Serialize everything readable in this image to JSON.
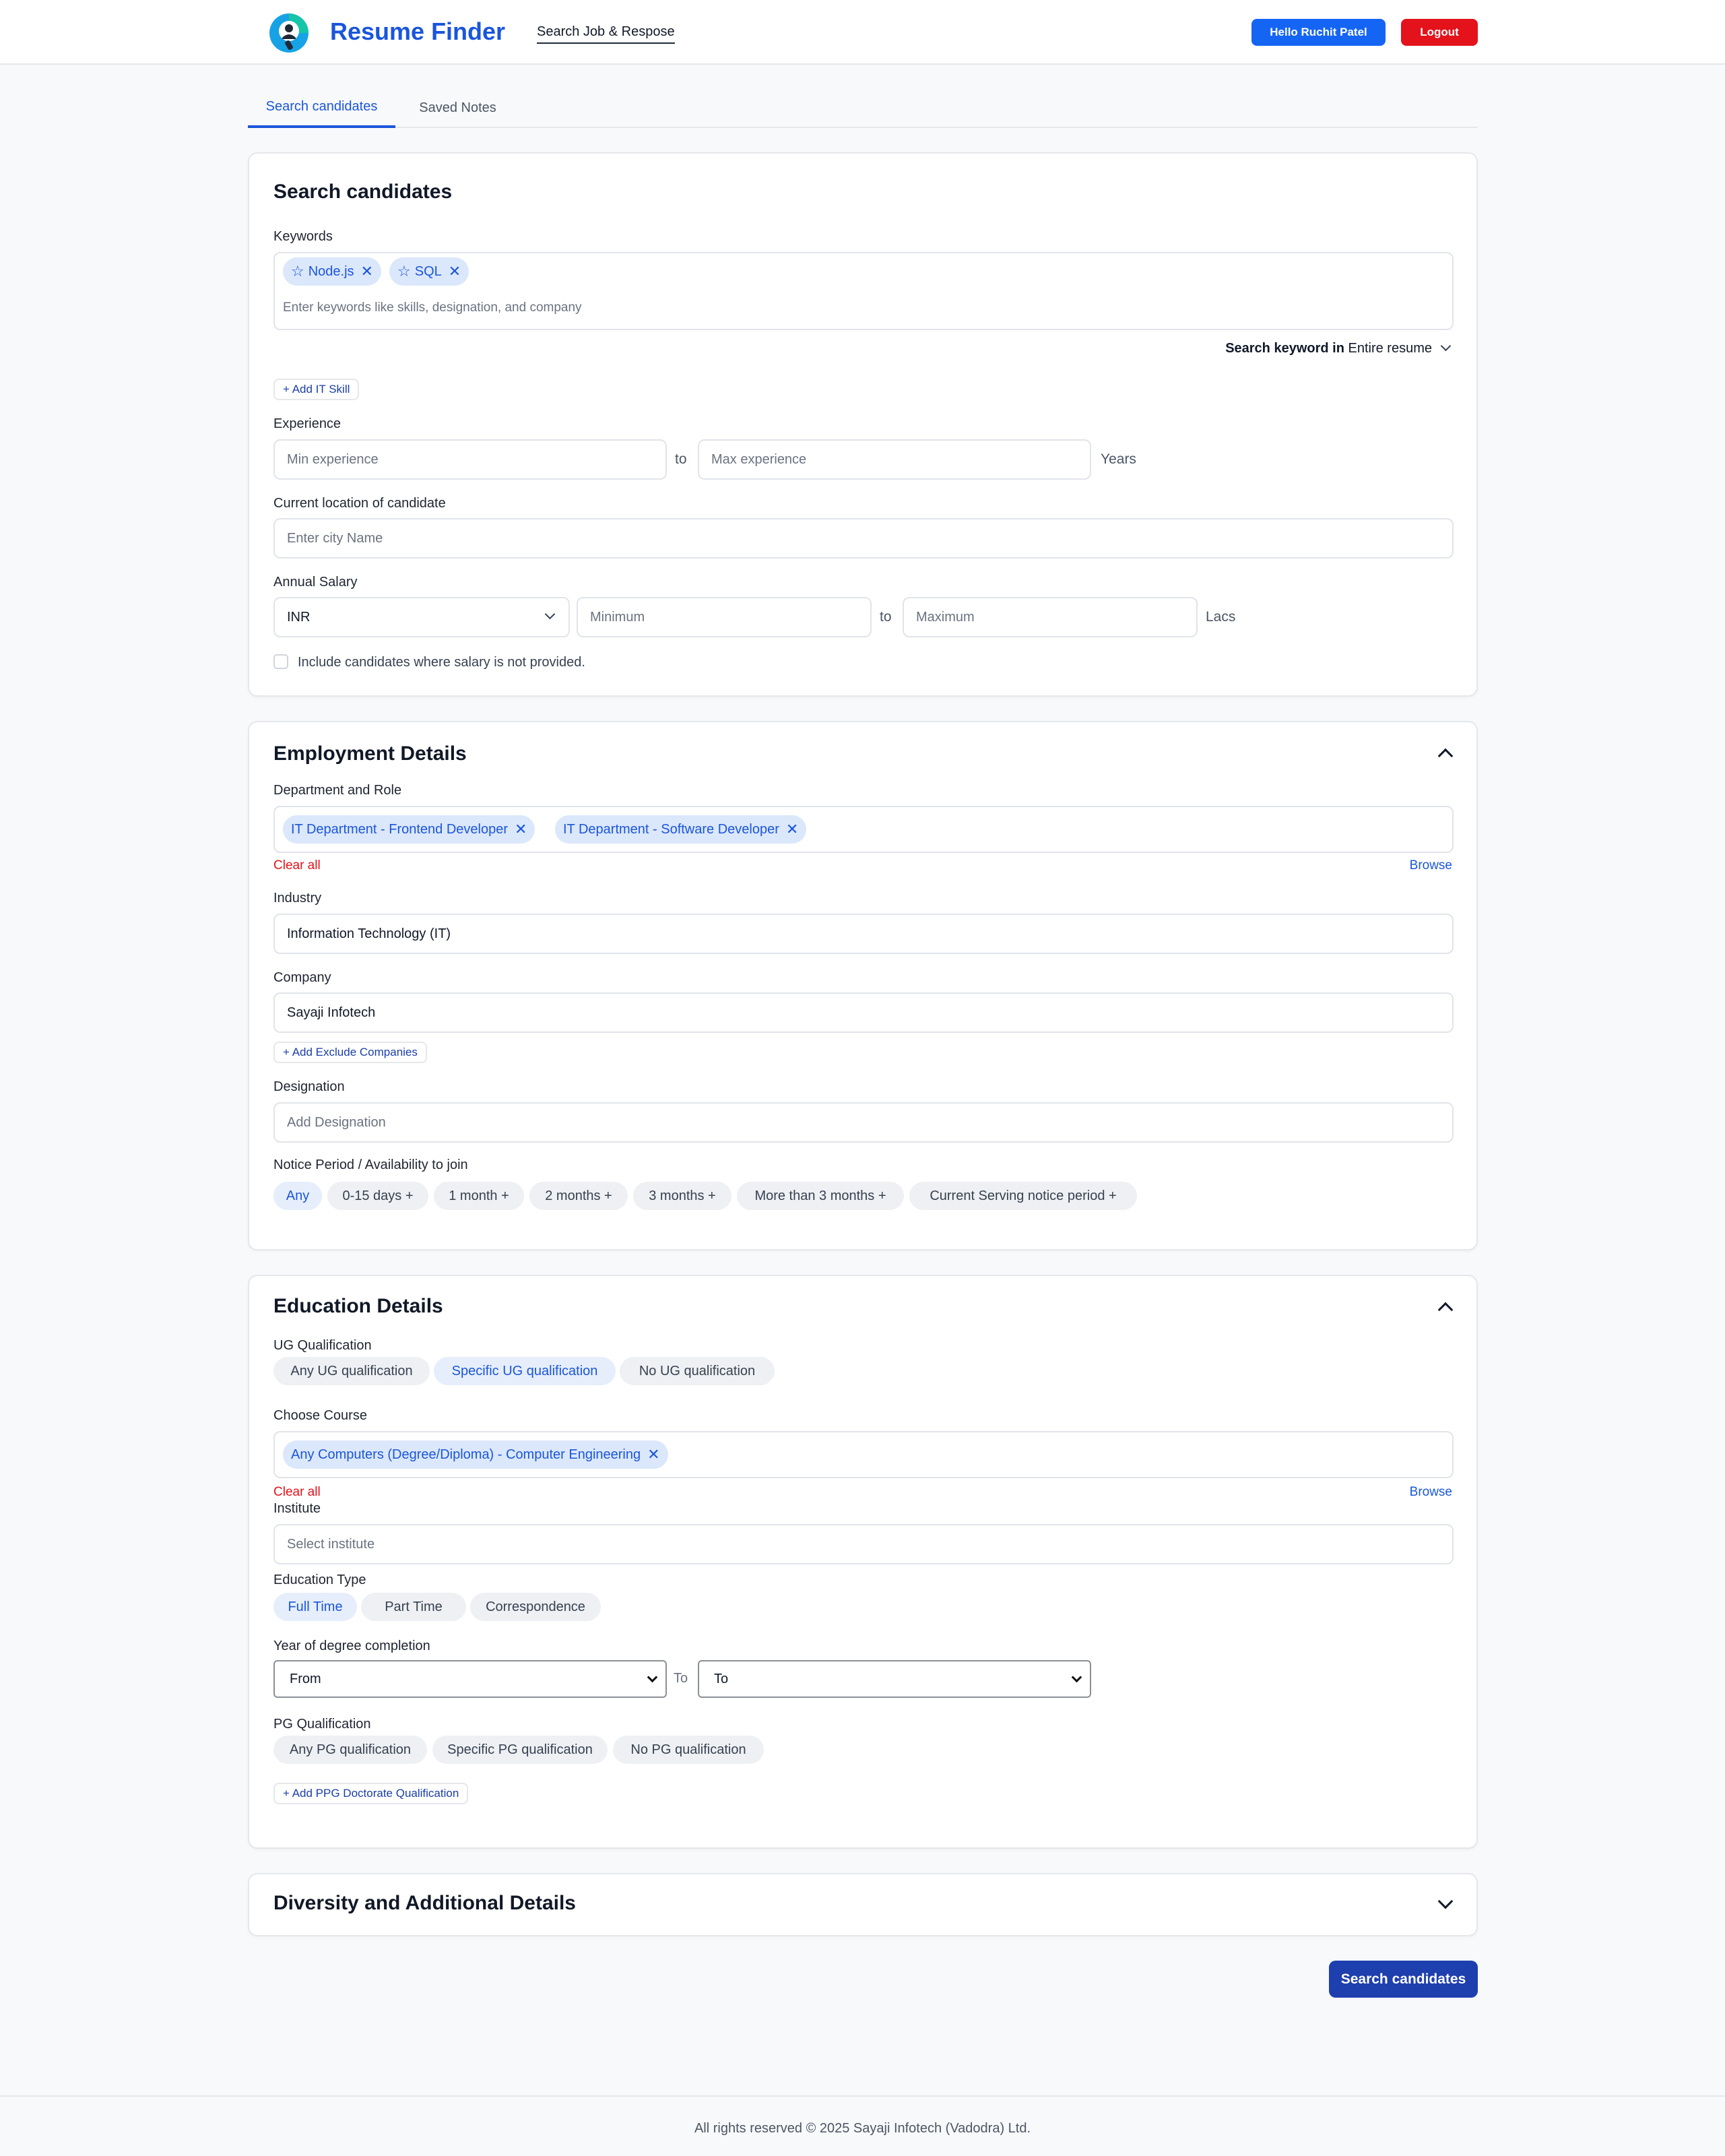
{
  "header": {
    "brand": "Resume Finder",
    "nav_link": "Search Job & Respose",
    "user_button": "Hello Ruchit Patel",
    "logout_button": "Logout"
  },
  "tabs": [
    {
      "label": "Search candidates",
      "active": true
    },
    {
      "label": "Saved Notes",
      "active": false
    }
  ],
  "search": {
    "title": "Search candidates",
    "keywords_label": "Keywords",
    "keywords": [
      "Node.js",
      "SQL"
    ],
    "keywords_placeholder": "Enter keywords like skills, designation, and company",
    "search_in_label": "Search keyword in",
    "search_in_value": "Entire resume",
    "add_skill": "+ Add IT Skill",
    "experience_label": "Experience",
    "min_exp_placeholder": "Min experience",
    "to": "to",
    "max_exp_placeholder": "Max experience",
    "years": "Years",
    "location_label": "Current location of candidate",
    "location_placeholder": "Enter city Name",
    "salary_label": "Annual Salary",
    "currency": "INR",
    "min_salary_placeholder": "Minimum",
    "max_salary_placeholder": "Maximum",
    "lacs": "Lacs",
    "include_label": "Include candidates where salary is not provided."
  },
  "employment": {
    "title": "Employment Details",
    "dept_label": "Department and Role",
    "dept_chips": [
      "IT Department - Frontend Developer",
      "IT Department - Software Developer"
    ],
    "clear_all": "Clear all",
    "browse": "Browse",
    "industry_label": "Industry",
    "industry_value": "Information Technology (IT)",
    "company_label": "Company",
    "company_value": "Sayaji Infotech",
    "add_exclude": "+ Add Exclude Companies",
    "designation_label": "Designation",
    "designation_placeholder": "Add Designation",
    "notice_label": "Notice Period / Availability to join",
    "notice_options": [
      "Any",
      "0-15 days +",
      "1 month +",
      "2 months +",
      "3 months +",
      "More than 3 months +",
      "Current Serving notice period +"
    ]
  },
  "education": {
    "title": "Education Details",
    "ug_label": "UG Qualification",
    "ug_options": [
      "Any UG qualification",
      "Specific UG qualification",
      "No UG qualification"
    ],
    "course_label": "Choose Course",
    "course_chips": [
      "Any Computers (Degree/Diploma) - Computer Engineering"
    ],
    "clear_all": "Clear all",
    "browse": "Browse",
    "institute_label": "Institute",
    "institute_placeholder": "Select institute",
    "edu_type_label": "Education Type",
    "edu_types": [
      "Full Time",
      "Part Time",
      "Correspondence"
    ],
    "year_label": "Year of degree completion",
    "from": "From",
    "to_label": "To",
    "to_value": "To",
    "pg_label": "PG Qualification",
    "pg_options": [
      "Any PG qualification",
      "Specific PG qualification",
      "No PG qualification"
    ],
    "add_ppg": "+ Add PPG Doctorate Qualification"
  },
  "diversity": {
    "title": "Diversity and Additional Details"
  },
  "search_button": "Search candidates",
  "footer": "All rights reserved © 2025 Sayaji Infotech (Vadodra) Ltd.",
  "colors": {
    "primary": "#1a56db",
    "danger": "#e3121b",
    "chip_bg": "#dbe7fb",
    "submit": "#1e3fae"
  }
}
